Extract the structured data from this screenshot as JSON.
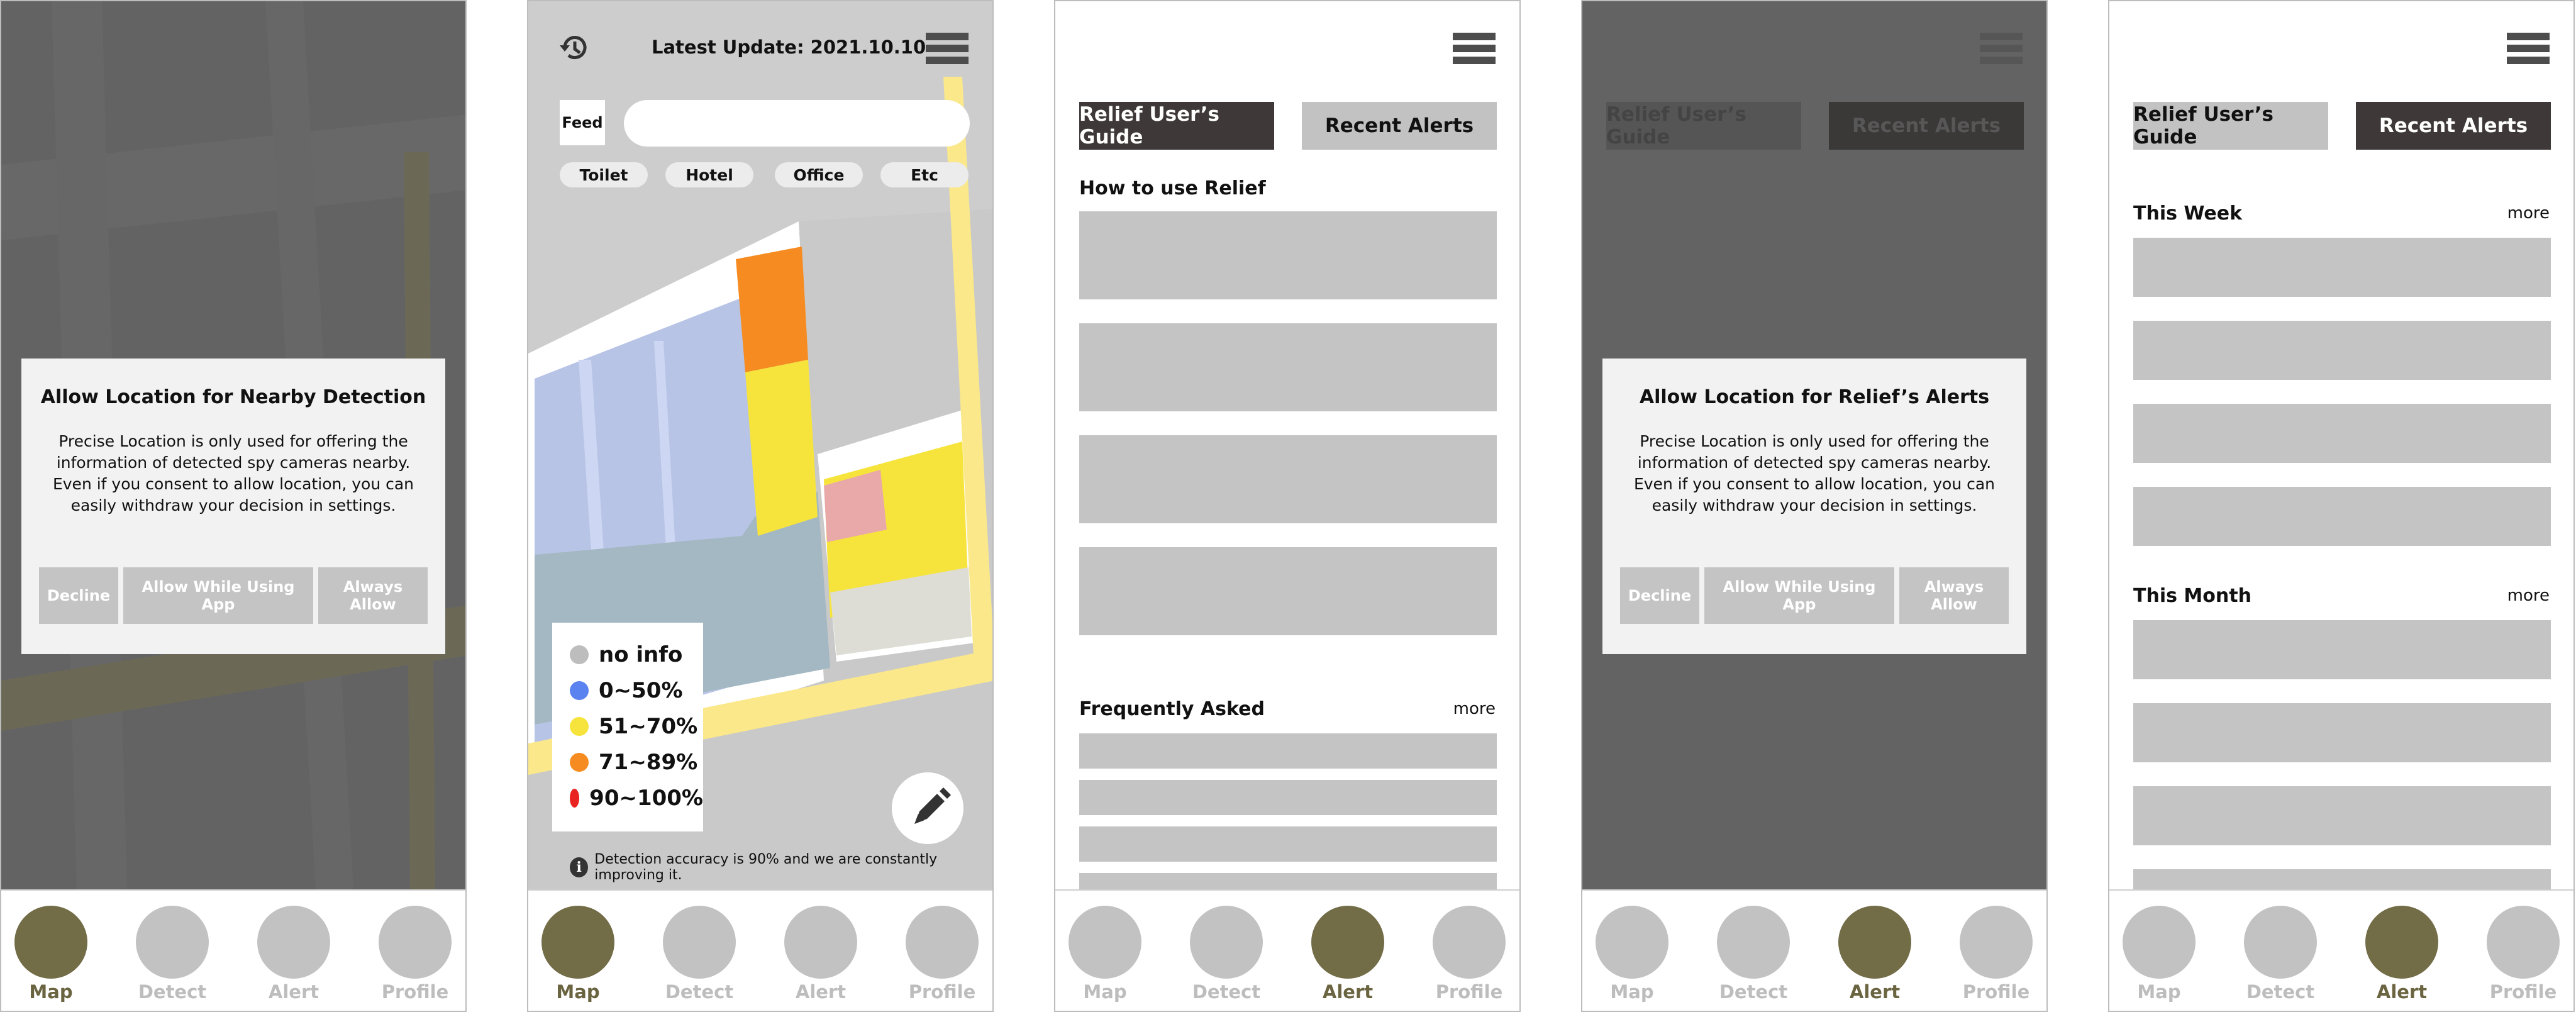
{
  "nav": [
    "Map",
    "Detect",
    "Alert",
    "Profile"
  ],
  "screen1": {
    "dialog": {
      "title": "Allow Location for Nearby Detection",
      "body": "Precise Location is only used for offering the information of detected spy cameras nearby. Even if you consent to allow location, you can easily withdraw your decision in settings.",
      "buttons": [
        "Decline",
        "Allow While Using App",
        "Always Allow"
      ]
    }
  },
  "screen2": {
    "update_text": "Latest Update: 2021.10.10",
    "feed_label": "Feed",
    "search": {
      "value": "",
      "placeholder": ""
    },
    "chips": [
      "Toilet",
      "Hotel",
      "Office",
      "Etc"
    ],
    "legend": [
      {
        "label": "no info",
        "color": "#bdbdbd"
      },
      {
        "label": "0~50%",
        "color": "#5b83f0"
      },
      {
        "label": "51~70%",
        "color": "#f6e43d"
      },
      {
        "label": "71~89%",
        "color": "#f68c21"
      },
      {
        "label": "90~100%",
        "color": "#e82322"
      }
    ],
    "note": "Detection accuracy is 90% and we are constantly improving it."
  },
  "screen3": {
    "tabs": [
      "Relief User’s Guide",
      "Recent Alerts"
    ],
    "section1": "How to use Relief",
    "section2": "Frequently Asked",
    "more": "more"
  },
  "screen4": {
    "tabs": [
      "Relief User’s Guide",
      "Recent Alerts"
    ],
    "dialog": {
      "title": "Allow Location for Relief’s Alerts",
      "body": "Precise Location is only used for offering the information of detected spy cameras nearby. Even if you consent to allow location, you can easily withdraw your decision in settings.",
      "buttons": [
        "Decline",
        "Allow While Using App",
        "Always Allow"
      ]
    }
  },
  "screen5": {
    "tabs": [
      "Relief User’s Guide",
      "Recent Alerts"
    ],
    "week": "This Week",
    "month": "This Month",
    "more": "more"
  },
  "colors": {
    "accent": "#726c47",
    "dark_tab": "#3e3838",
    "placeholder_gray": "#c4c4c4"
  }
}
